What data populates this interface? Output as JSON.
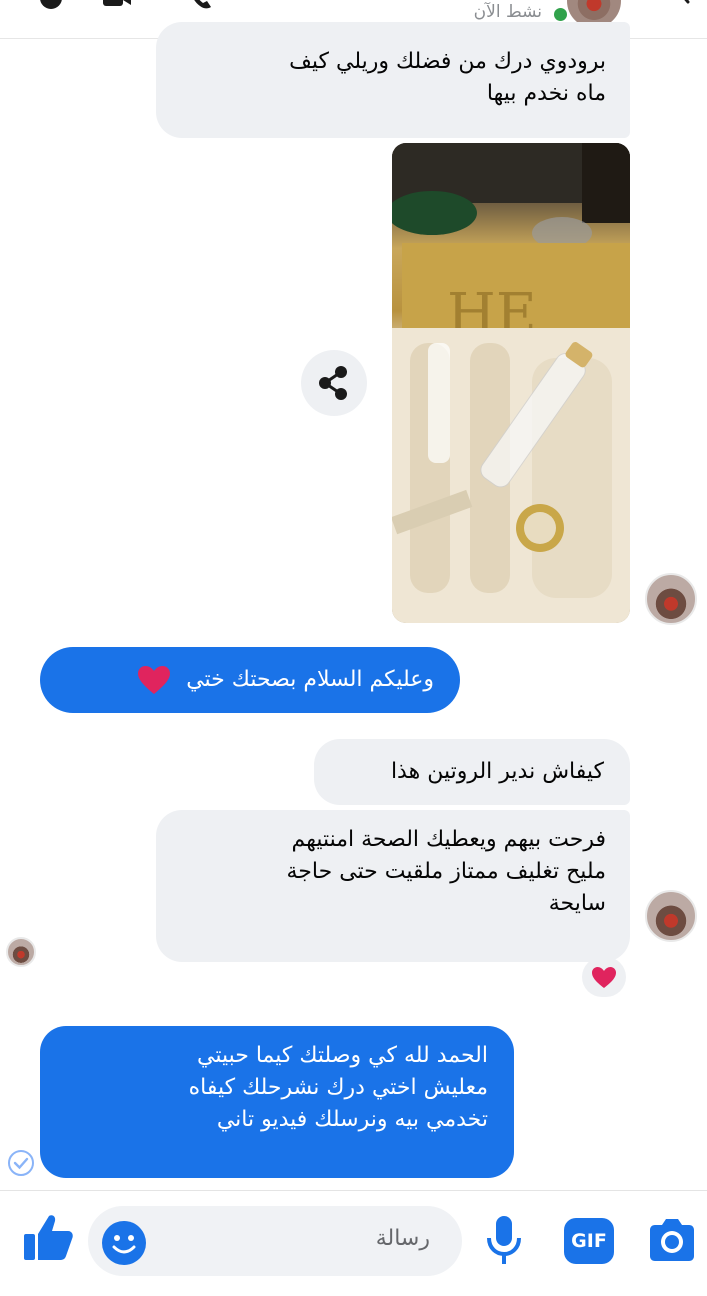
{
  "header": {
    "status": "نشط الآن"
  },
  "messages": [
    {
      "id": "m1",
      "side": "incoming",
      "text_lines": [
        "برودوي درك من فضلك وريلي كيف",
        "ماه نخدم بيها"
      ]
    },
    {
      "id": "m2",
      "side": "incoming",
      "type": "photo"
    },
    {
      "id": "m3",
      "side": "outgoing",
      "text": "وعليكم السلام بصحتك ختي"
    },
    {
      "id": "m4",
      "side": "incoming",
      "text": "كيفاش ندير الروتين هذا"
    },
    {
      "id": "m5",
      "side": "incoming",
      "text_lines": [
        "فرحت بيهم ويعطيك الصحة امنتيهم",
        "مليح تغليف ممتاز ملقيت حتى حاجة",
        "سايحة"
      ],
      "reaction": "heart"
    },
    {
      "id": "m6",
      "side": "outgoing",
      "text_lines": [
        "الحمد لله كي وصلتك كيما حبيتي",
        "معليش اختي درك نشرحلك كيفاه",
        "تخدمي بيه ونرسلك فيديو تاني"
      ]
    }
  ],
  "composer": {
    "placeholder": "رسالة",
    "gif_label": "GIF"
  },
  "colors": {
    "accent": "#1a73e8",
    "incoming_bubble": "#eef0f3",
    "online": "#31a24c",
    "heart": "#e0245e"
  }
}
